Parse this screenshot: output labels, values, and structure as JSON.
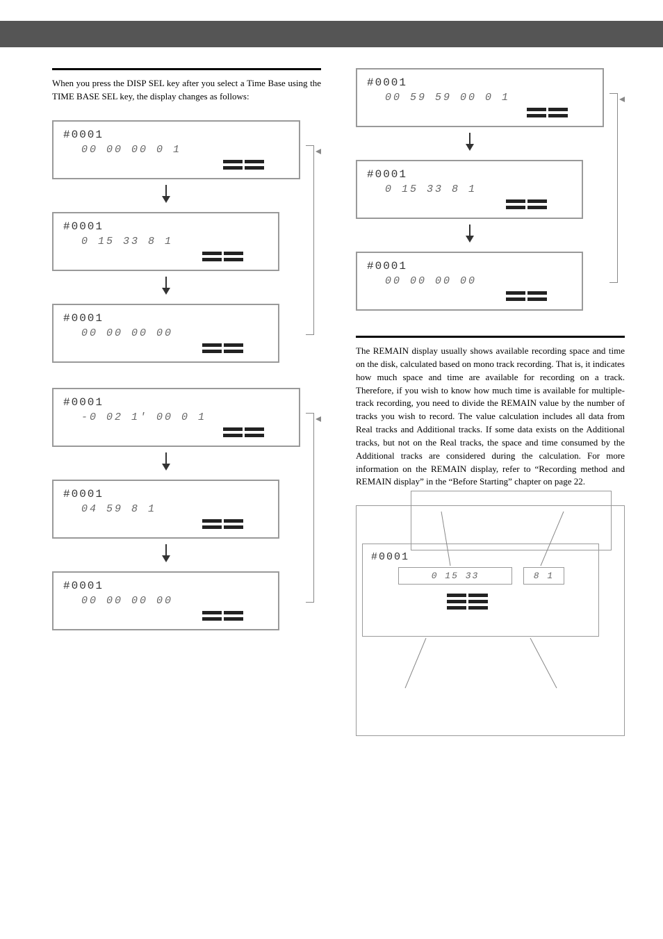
{
  "intro": "When you press the DISP SEL key after you select a Time Base using the TIME BASE SEL key, the display changes as follows:",
  "left": {
    "group1": {
      "d1": {
        "prog": "#0001",
        "seg": "00  00  00  0 1"
      },
      "d2": {
        "prog": "#0001",
        "seg": "0  15  33       8 1"
      },
      "d3": {
        "prog": "#0001",
        "seg": "00  00  00  00"
      }
    },
    "group2": {
      "d1": {
        "prog": "#0001",
        "seg": "-0  02   1' 00  0 1"
      },
      "d2": {
        "prog": "#0001",
        "seg": "04  59           8 1"
      },
      "d3": {
        "prog": "#0001",
        "seg": "00  00  00  00"
      }
    }
  },
  "right": {
    "group1": {
      "d1": {
        "prog": "#0001",
        "seg": "00  59  59  00   0 1"
      },
      "d2": {
        "prog": "#0001",
        "seg": "0  15  33        8 1"
      },
      "d3": {
        "prog": "#0001",
        "seg": "00  00  00  00"
      }
    },
    "remain_text": "The REMAIN display usually shows available recording space and time on the disk, calculated based on mono track recording. That is, it indicates how much space and time are available for recording on a track. Therefore, if you wish to know how much time is available for multiple-track recording, you need to divide the REMAIN value by the number of tracks you wish to record. The value calculation includes all data from Real tracks and Additional tracks. If some data exists on the Additional tracks, but not on the Real tracks, the space and time consumed by the Additional tracks are considered during the calculation. For more information on the REMAIN display, refer to “Recording method and REMAIN display” in the “Before Starting” chapter on page 22.",
    "diagram": {
      "prog": "#0001",
      "main_seg": "0   15  33",
      "side_seg": "8 1"
    }
  }
}
